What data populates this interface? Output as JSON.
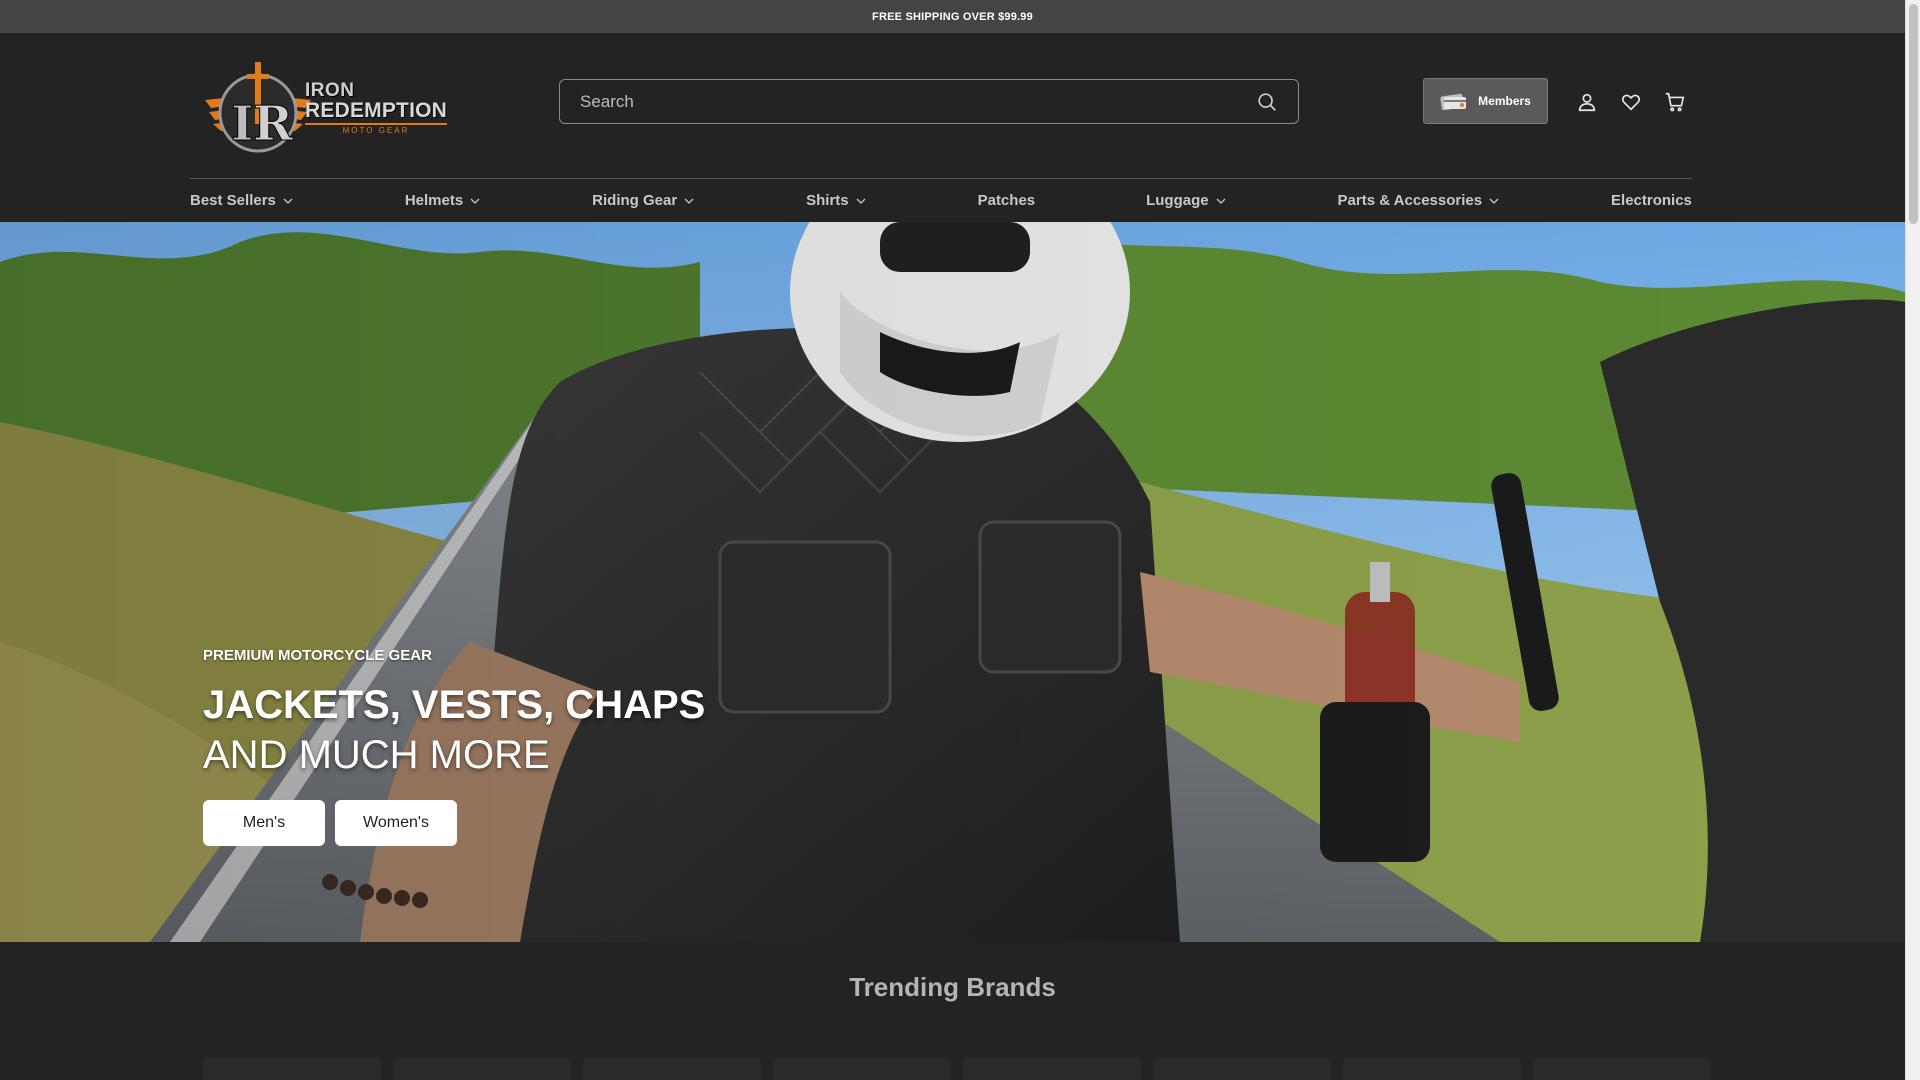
{
  "announcement": {
    "text": "FREE SHIPPING OVER $99.99"
  },
  "brand": {
    "logo_line1": "IRON",
    "logo_line2": "REDEMPTION",
    "logo_line3": "MOTO GEAR",
    "colors": {
      "accent": "#e07b1c",
      "header_bg": "#232323",
      "announce_bg": "#444444"
    }
  },
  "search": {
    "placeholder": "Search",
    "icon": "search-icon"
  },
  "header": {
    "members_label": "Members",
    "icons": [
      "account-icon",
      "wishlist-heart-icon",
      "cart-icon"
    ]
  },
  "nav": {
    "items": [
      {
        "label": "Best Sellers",
        "has_dropdown": true
      },
      {
        "label": "Helmets",
        "has_dropdown": true
      },
      {
        "label": "Riding Gear",
        "has_dropdown": true
      },
      {
        "label": "Shirts",
        "has_dropdown": true
      },
      {
        "label": "Patches",
        "has_dropdown": false
      },
      {
        "label": "Luggage",
        "has_dropdown": true
      },
      {
        "label": "Parts & Accessories",
        "has_dropdown": true
      },
      {
        "label": "Electronics",
        "has_dropdown": false
      }
    ]
  },
  "hero": {
    "eyebrow": "PREMIUM MOTORCYCLE GEAR",
    "title": "JACKETS, VESTS, CHAPS",
    "subtitle": "AND MUCH MORE",
    "buttons": {
      "mens": "Men's",
      "womens": "Women's"
    }
  },
  "trending": {
    "title": "Trending Brands"
  }
}
